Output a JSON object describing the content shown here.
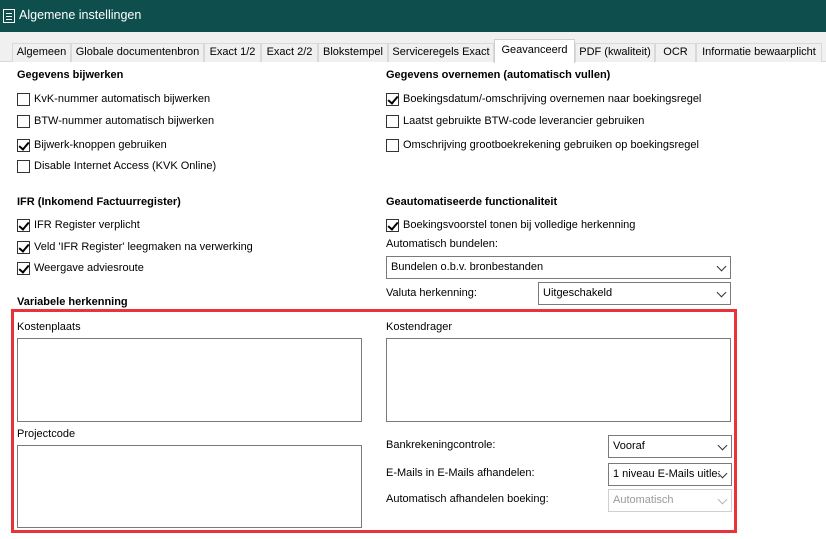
{
  "window": {
    "title": "Algemene instellingen"
  },
  "tabs": [
    {
      "label": "Algemeen"
    },
    {
      "label": "Globale documentenbron"
    },
    {
      "label": "Exact 1/2"
    },
    {
      "label": "Exact 2/2"
    },
    {
      "label": "Blokstempel"
    },
    {
      "label": "Serviceregels Exact"
    },
    {
      "label": "Geavanceerd"
    },
    {
      "label": "PDF (kwaliteit)"
    },
    {
      "label": "OCR"
    },
    {
      "label": "Informatie bewaarplicht"
    }
  ],
  "active_tab": "Geavanceerd",
  "gegevens_bijwerken": {
    "heading": "Gegevens bijwerken",
    "items": [
      {
        "label": "KvK-nummer automatisch bijwerken",
        "checked": false
      },
      {
        "label": "BTW-nummer automatisch bijwerken",
        "checked": false
      },
      {
        "label": "Bijwerk-knoppen gebruiken",
        "checked": true
      },
      {
        "label": "Disable Internet Access (KVK Online)",
        "checked": false
      }
    ]
  },
  "gegevens_overnemen": {
    "heading": "Gegevens overnemen (automatisch vullen)",
    "items": [
      {
        "label": "Boekingsdatum/-omschrijving overnemen naar boekingsregel",
        "checked": true
      },
      {
        "label": "Laatst gebruikte BTW-code leverancier gebruiken",
        "checked": false
      },
      {
        "label": "Omschrijving grootboekrekening gebruiken op boekingsregel",
        "checked": false
      }
    ]
  },
  "ifr": {
    "heading": "IFR (Inkomend Factuurregister)",
    "items": [
      {
        "label": "IFR Register verplicht",
        "checked": true
      },
      {
        "label": "Veld 'IFR Register' leegmaken na verwerking",
        "checked": true
      },
      {
        "label": "Weergave adviesroute",
        "checked": true
      }
    ]
  },
  "geautomatiseerd": {
    "heading": "Geautomatiseerde functionaliteit",
    "items": [
      {
        "label": "Boekingsvoorstel tonen bij volledige herkenning",
        "checked": true
      }
    ],
    "bundelen_label": "Automatisch bundelen:",
    "bundelen_value": "Bundelen o.b.v. bronbestanden",
    "valuta_label": "Valuta herkenning:",
    "valuta_value": "Uitgeschakeld"
  },
  "variabele_herkenning": {
    "heading": "Variabele herkenning",
    "kostenplaats_label": "Kostenplaats",
    "kostendrager_label": "Kostendrager",
    "projectcode_label": "Projectcode",
    "bankrekening_label": "Bankrekeningcontrole:",
    "bankrekening_value": "Vooraf",
    "emails_label": "E-Mails in E-Mails afhandelen:",
    "emails_value": "1 niveau E-Mails uitle:",
    "afhandelen_label": "Automatisch afhandelen boeking:",
    "afhandelen_value": "Automatisch"
  },
  "colors": {
    "titlebar": "#0e4e4c",
    "highlight": "#e8333b"
  }
}
